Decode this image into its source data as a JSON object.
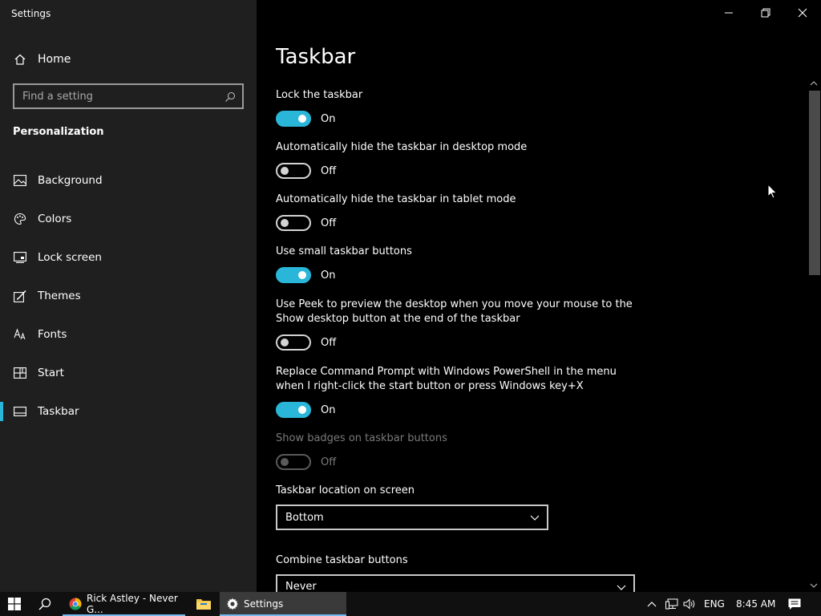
{
  "window": {
    "title": "Settings"
  },
  "sidebar": {
    "home_label": "Home",
    "search_placeholder": "Find a setting",
    "section_title": "Personalization",
    "items": [
      {
        "label": "Background",
        "icon": "image-icon"
      },
      {
        "label": "Colors",
        "icon": "palette-icon"
      },
      {
        "label": "Lock screen",
        "icon": "lock-screen-icon"
      },
      {
        "label": "Themes",
        "icon": "brush-icon"
      },
      {
        "label": "Fonts",
        "icon": "font-icon"
      },
      {
        "label": "Start",
        "icon": "start-tiles-icon"
      },
      {
        "label": "Taskbar",
        "icon": "taskbar-icon",
        "active": true
      }
    ]
  },
  "main": {
    "title": "Taskbar",
    "settings": [
      {
        "label": "Lock the taskbar",
        "state": "On",
        "on": true
      },
      {
        "label": "Automatically hide the taskbar in desktop mode",
        "state": "Off",
        "on": false
      },
      {
        "label": "Automatically hide the taskbar in tablet mode",
        "state": "Off",
        "on": false
      },
      {
        "label": "Use small taskbar buttons",
        "state": "On",
        "on": true
      },
      {
        "label_line1": "Use Peek to preview the desktop when you move your mouse to the",
        "label_line2": "Show desktop button at the end of the taskbar",
        "state": "Off",
        "on": false
      },
      {
        "label_line1": "Replace Command Prompt with Windows PowerShell in the menu",
        "label_line2": "when I right-click the start button or press Windows key+X",
        "state": "On",
        "on": true
      },
      {
        "label": "Show badges on taskbar buttons",
        "state": "Off",
        "on": false,
        "disabled": true
      }
    ],
    "location": {
      "label": "Taskbar location on screen",
      "value": "Bottom"
    },
    "combine": {
      "label": "Combine taskbar buttons",
      "value": "Never"
    }
  },
  "taskbar": {
    "apps": [
      {
        "label": "Rick Astley - Never G...",
        "icon": "chrome-icon"
      },
      {
        "label": "Settings",
        "icon": "gear-icon"
      }
    ],
    "language": "ENG",
    "time": "8:45 AM"
  },
  "colors": {
    "accent": "#2ab6d8",
    "sidebar_bg": "#1f1f1f",
    "main_bg": "#000000"
  }
}
